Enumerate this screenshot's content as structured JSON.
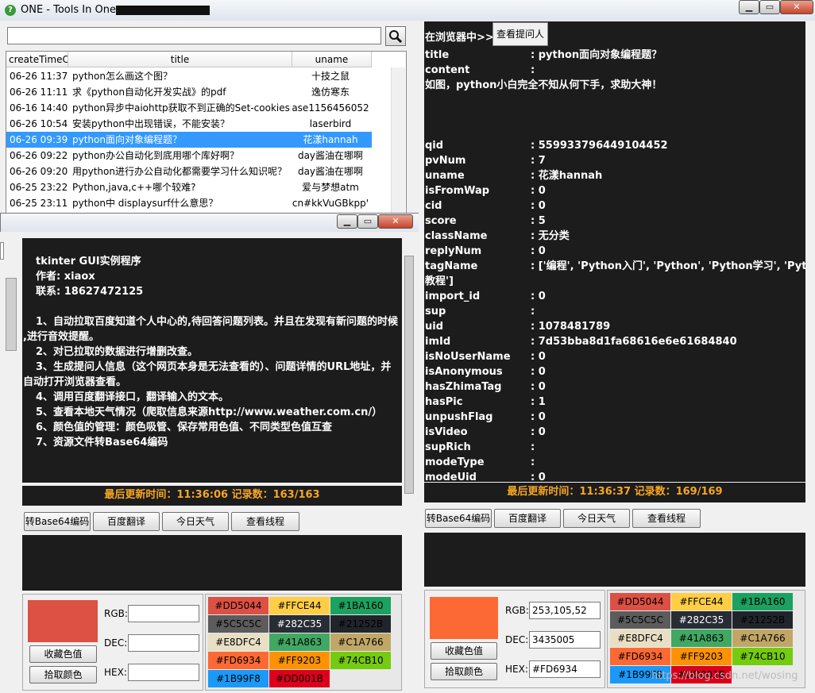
{
  "window": {
    "title": "ONE - Tools In One",
    "app_icon": "?"
  },
  "search": {
    "value": "",
    "placeholder": ""
  },
  "table": {
    "headers": [
      "createTimeC",
      "title",
      "uname"
    ],
    "rows": [
      {
        "time": "06-26 11:37",
        "title": "python怎么画这个图？",
        "uname": "十技之鼠"
      },
      {
        "time": "06-26 11:11",
        "title": "求《python自动化开发实战》的pdf",
        "uname": "逸仿寒东"
      },
      {
        "time": "06-16 14:40",
        "title": "python异步中aiohttp获取不到正确的Set-cookies的",
        "uname": "ase1156456052"
      },
      {
        "time": "06-26 10:54",
        "title": "安装python中出现错误，不能安装？",
        "uname": "laserbird"
      },
      {
        "time": "06-26 09:39",
        "title": "python面向对象编程题？",
        "uname": "花漾hannah"
      },
      {
        "time": "06-26 09:22",
        "title": "python办公自动化到底用哪个库好啊？",
        "uname": "day酱油在哪啊"
      },
      {
        "time": "06-26 09:20",
        "title": "用python进行办公自动化都需要学习什么知识呢？",
        "uname": "day酱油在哪啊"
      },
      {
        "time": "06-25 23:22",
        "title": "Python,java,c++哪个较难?",
        "uname": "爱与梦想atm"
      },
      {
        "time": "06-25 23:11",
        "title": "python中 displaysurf什么意思？",
        "uname": "cn#kkVuGBkpp'"
      }
    ],
    "selected_index": 4
  },
  "right": {
    "browser_label": "在浏览器中>>",
    "asker_button": "查看提问人",
    "details": [
      {
        "k": "title",
        "v": ": python面向对象编程题？"
      },
      {
        "k": "content",
        "v": ":"
      },
      {
        "k": "",
        "v": "如图，python小白完全不知从何下手，求助大神！"
      },
      {
        "k": "",
        "v": ""
      },
      {
        "k": "",
        "v": ""
      },
      {
        "k": "",
        "v": ""
      },
      {
        "k": "qid",
        "v": ": 559933796449104452"
      },
      {
        "k": "pvNum",
        "v": ": 7"
      },
      {
        "k": "uname",
        "v": ": 花漾hannah"
      },
      {
        "k": "isFromWap",
        "v": ": 0"
      },
      {
        "k": "cid",
        "v": ": 0"
      },
      {
        "k": "score",
        "v": ": 5"
      },
      {
        "k": "className",
        "v": ": 无分类"
      },
      {
        "k": "replyNum",
        "v": ": 0"
      },
      {
        "k": "tagName",
        "v": ": ['编程', 'Python入门', 'Python', 'Python学习', 'Python"
      },
      {
        "k": "",
        "v": "教程']"
      },
      {
        "k": "import_id",
        "v": ": 0"
      },
      {
        "k": "sup",
        "v": ":"
      },
      {
        "k": "uid",
        "v": ": 1078481789"
      },
      {
        "k": "imId",
        "v": ": 7d53bba8d1fa68616e6e61684840"
      },
      {
        "k": "isNoUserName",
        "v": ": 0"
      },
      {
        "k": "isAnonymous",
        "v": ": 0"
      },
      {
        "k": "hasZhimaTag",
        "v": ": 0"
      },
      {
        "k": "hasPic",
        "v": ": 1"
      },
      {
        "k": "unpushFlag",
        "v": ": 0"
      },
      {
        "k": "isVideo",
        "v": ": 0"
      },
      {
        "k": "supRich",
        "v": ":"
      },
      {
        "k": "modeType",
        "v": ":"
      },
      {
        "k": "modeUid",
        "v": ": 0"
      }
    ],
    "status": "最后更新时间：11:36:37  记录数：169/169",
    "rgb": "253,105,52",
    "dec": "3435005",
    "hex": "#FD6934",
    "current_color": "#FD6934"
  },
  "left": {
    "lines": [
      "tkinter GUI实例程序",
      "作者: xiaox",
      "联系: 18627472125",
      "",
      "1、自动拉取百度知道个人中心的,待回答问题列表。并且在发现有新问题的时候",
      ",进行音效提醒。",
      "2、对已拉取的数据进行增删改查。",
      "3、生成提问人信息（这个网页本身是无法查看的）、问题详情的URL地址，并",
      "自动打开浏览器查看。",
      "4、调用百度翻译接口，翻译输入的文本。",
      "5、查看本地天气情况（爬取信息来源http://www.weather.com.cn/）",
      "6、颜色值的管理：颜色吸管、保存常用色值、不同类型色值互查",
      "7、资源文件转Base64编码"
    ],
    "status": "最后更新时间：11:36:06  记录数：163/163",
    "rgb": "",
    "dec": "",
    "hex": "",
    "current_color": "#DD5044"
  },
  "buttons": {
    "base64": "转Base64编码",
    "translate": "百度翻译",
    "weather": "今日天气",
    "threads": "查看线程"
  },
  "color_labels": {
    "rgb": "RGB:",
    "dec": "DEC:",
    "hex": "HEX:",
    "save": "收藏色值",
    "pick": "拾取颜色"
  },
  "swatches": [
    "#DD5044",
    "#FFCE44",
    "#1BA160",
    "#5C5C5C",
    "#282C35",
    "#21252B",
    "#E8DFC4",
    "#41A863",
    "#C1A766",
    "#FD6934",
    "#FF9203",
    "#74CB10",
    "#1B99F8",
    "#DD001B"
  ],
  "swatch_text_light": [
    false,
    false,
    false,
    false,
    true,
    false,
    false,
    false,
    false,
    false,
    false,
    false,
    false,
    false
  ],
  "watermark": "https://blog.csdn.net/wosing"
}
